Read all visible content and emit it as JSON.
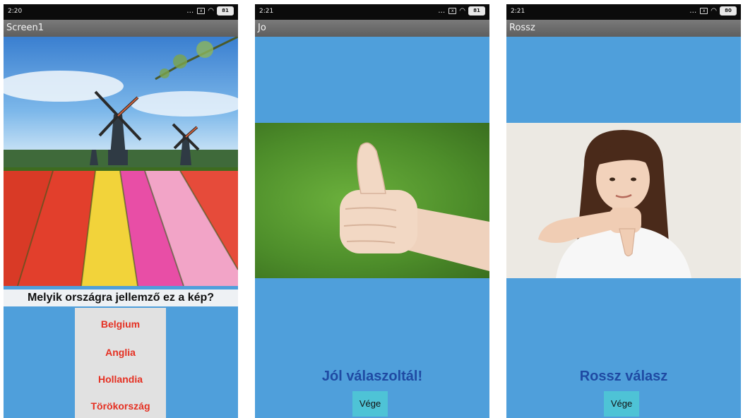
{
  "screens": [
    {
      "status": {
        "time": "2:20",
        "battery": "81"
      },
      "title": "Screen1",
      "question": "Melyik országra jellemző ez a kép?",
      "options": [
        "Belgium",
        "Anglia",
        "Hollandia",
        "Törökország"
      ]
    },
    {
      "status": {
        "time": "2:21",
        "battery": "81"
      },
      "title": "Jo",
      "result": "Jól válaszoltál!",
      "button": "Vége"
    },
    {
      "status": {
        "time": "2:21",
        "battery": "80"
      },
      "title": "Rossz",
      "result": "Rossz válasz",
      "button": "Vége"
    }
  ],
  "colors": {
    "background": "#4f9fdb",
    "titlebar": "#6b6b6b",
    "option_text": "#e53022",
    "result_text": "#1f4aa3",
    "button": "#4ec3d6"
  }
}
